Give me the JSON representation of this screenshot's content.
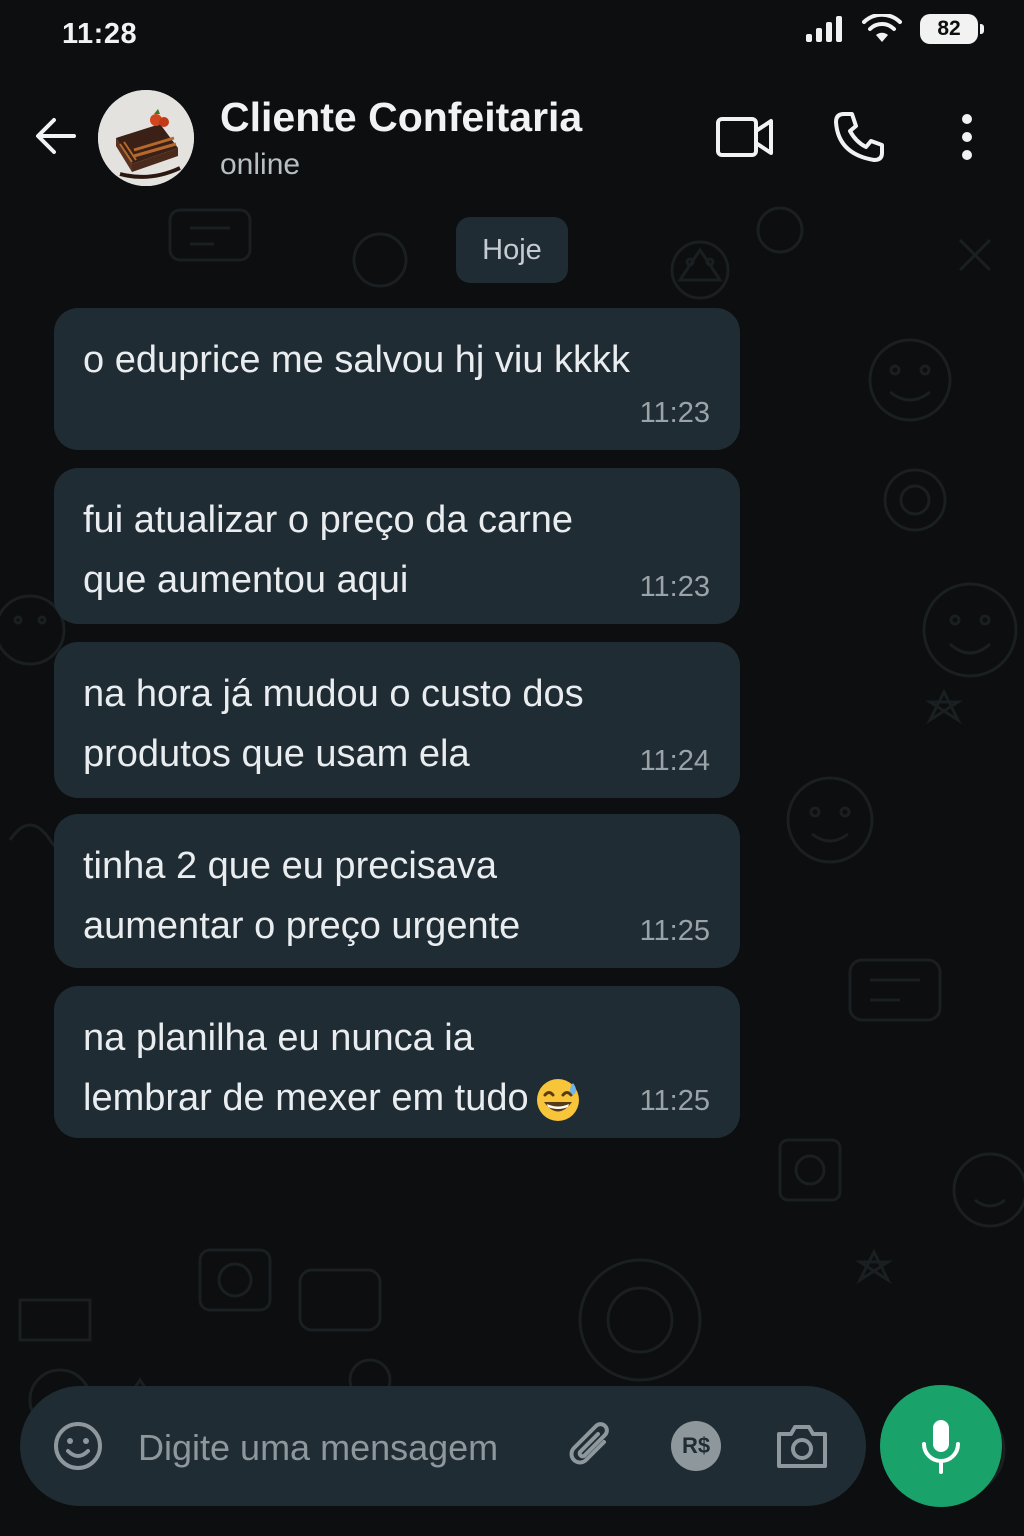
{
  "status_bar": {
    "time": "11:28",
    "battery": "82",
    "icons": [
      "signal-icon",
      "wifi-icon",
      "battery-icon"
    ]
  },
  "header": {
    "contact_name": "Cliente Confeitaria",
    "contact_status": "online",
    "icons": [
      "back-arrow-icon",
      "video-call-icon",
      "voice-call-icon",
      "more-options-icon"
    ]
  },
  "date_chip": "Hoje",
  "messages": [
    {
      "text": "o eduprice me salvou hj viu kkkk",
      "time": "11:23"
    },
    {
      "text": "fui atualizar o preço da carne que aumentou aqui",
      "time": "11:23"
    },
    {
      "text": "na hora já mudou o custo dos produtos que usam ela",
      "time": "11:24"
    },
    {
      "text": "tinha 2 que eu precisava aumentar o preço urgente",
      "time": "11:25"
    },
    {
      "text": "na planilha eu nunca ia lembrar de mexer em tudo",
      "time": "11:25",
      "emoji": "grinning-face-with-sweat"
    }
  ],
  "composer": {
    "placeholder": "Digite uma mensagem",
    "currency_badge": "R$",
    "icons": [
      "emoji-icon",
      "attach-icon",
      "currency-icon",
      "camera-icon",
      "mic-icon"
    ]
  },
  "colors": {
    "background": "#0c0e0f",
    "bubble": "#202c33",
    "accent": "#1aa26b",
    "composer": "#1f2c33"
  }
}
